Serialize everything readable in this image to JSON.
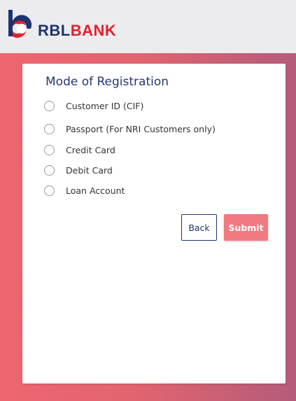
{
  "brand": {
    "name_part1": "RBL",
    "name_part2": "BANK",
    "color_primary": "#1d3470",
    "color_accent": "#e2202d"
  },
  "form": {
    "title": "Mode of Registration",
    "options": [
      {
        "label": "Customer ID (CIF)",
        "selected": false
      },
      {
        "label": "Passport (For NRI Customers only)",
        "selected": false
      },
      {
        "label": "Credit Card",
        "selected": false
      },
      {
        "label": "Debit Card",
        "selected": false
      },
      {
        "label": "Loan Account",
        "selected": false
      }
    ],
    "back_label": "Back",
    "submit_label": "Submit"
  },
  "icons": {
    "logo": "rbl-logo-icon",
    "radio": "radio-unchecked-icon"
  }
}
